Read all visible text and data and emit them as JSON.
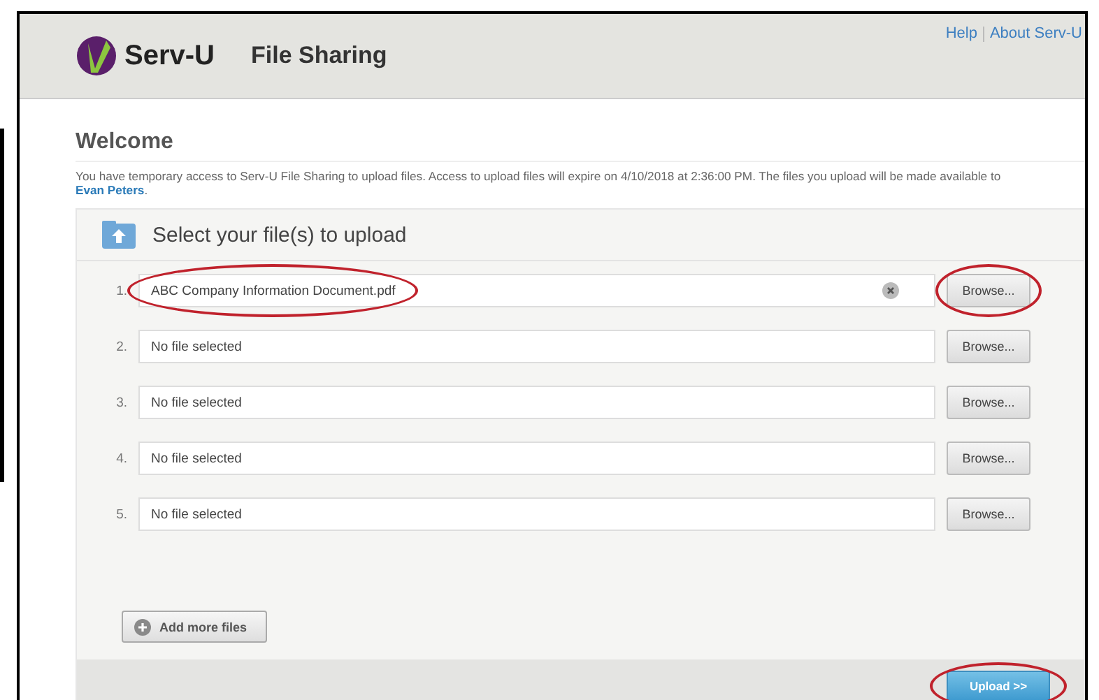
{
  "header": {
    "brand": "Serv-U",
    "title": "File Sharing",
    "links": [
      "Help",
      "About Serv-U"
    ]
  },
  "welcome": {
    "heading": "Welcome",
    "message": "You have temporary access to Serv-U File Sharing to upload files. Access to upload files will expire on 4/10/2018 at 2:36:00 PM. The files you upload will be made available to ",
    "recipient": "Evan Peters",
    "end": "."
  },
  "panel": {
    "title": "Select your file(s) to upload"
  },
  "files": [
    {
      "number": "1.",
      "value": "ABC Company Information Document.pdf",
      "highlighted": true,
      "browse": "Browse...",
      "browse_highlighted": true
    },
    {
      "number": "2.",
      "placeholder": "No file selected",
      "highlighted": false,
      "browse": "Browse...",
      "browse_highlighted": false
    },
    {
      "number": "3.",
      "placeholder": "No file selected",
      "highlighted": false,
      "browse": "Browse...",
      "browse_highlighted": false
    },
    {
      "number": "4.",
      "placeholder": "No file selected",
      "highlighted": false,
      "browse": "Browse...",
      "browse_highlighted": false
    },
    {
      "number": "5.",
      "placeholder": "No file selected",
      "highlighted": false,
      "browse": "Browse...",
      "browse_highlighted": false
    }
  ],
  "add_button": "Add more files",
  "upload_button": {
    "label": "Upload >>",
    "highlighted": true
  }
}
